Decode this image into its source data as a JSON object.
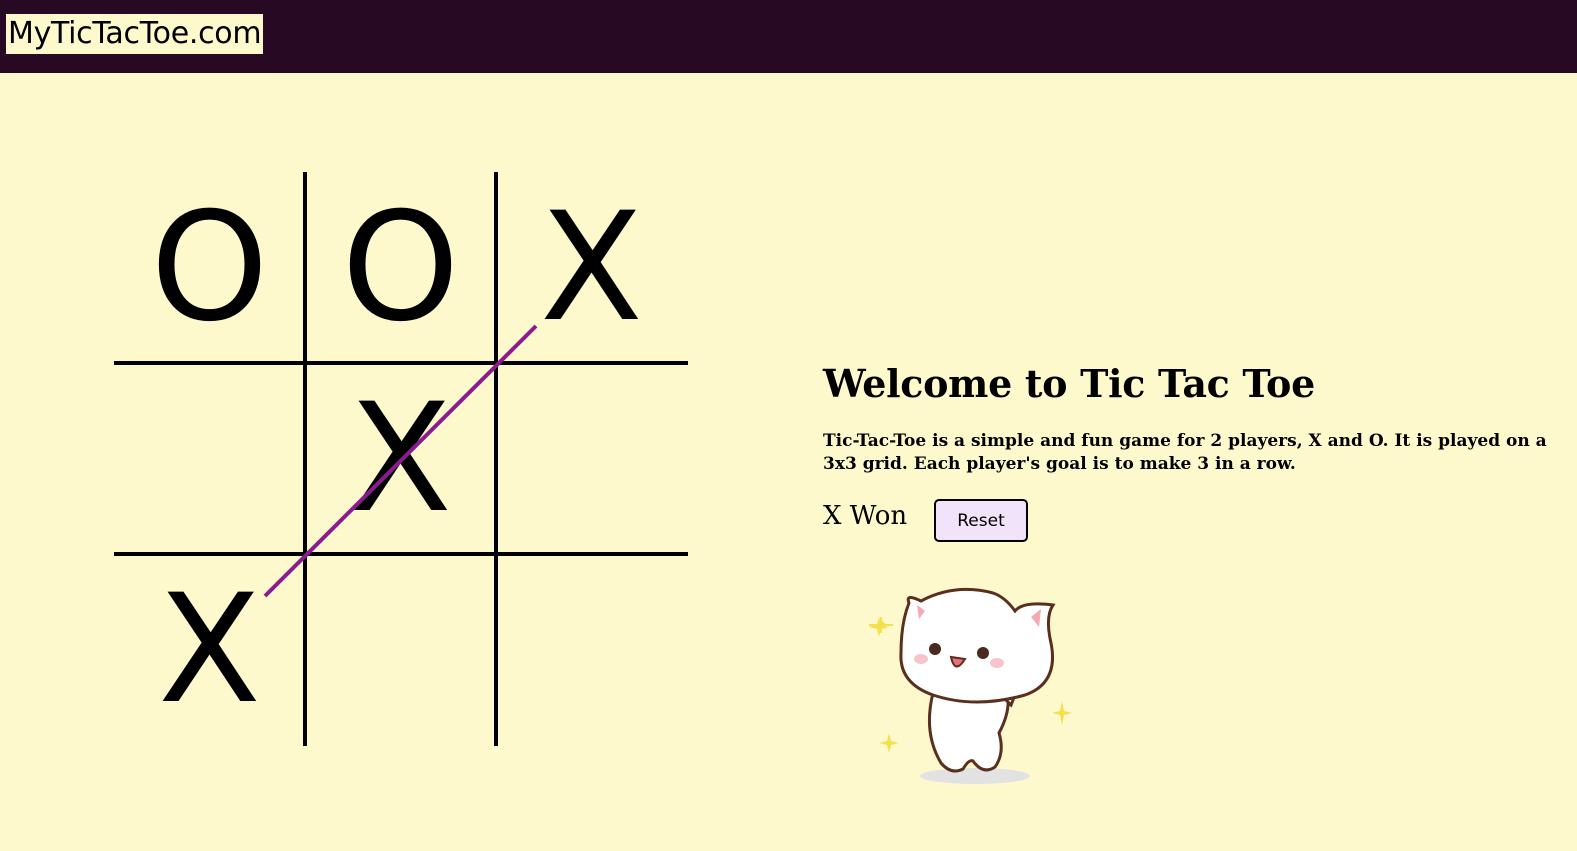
{
  "site": {
    "title": "MyTicTacToe.com"
  },
  "colors": {
    "header_bg": "#270924",
    "page_bg": "#fef8cd",
    "win_line": "#8b1c8f",
    "button_bg": "#f1e4fa"
  },
  "board": {
    "cells": [
      [
        "O",
        "O",
        "X"
      ],
      [
        "",
        "X",
        ""
      ],
      [
        "X",
        "",
        ""
      ]
    ],
    "winning_line": "anti-diagonal"
  },
  "info": {
    "heading": "Welcome to Tic Tac Toe",
    "description": "Tic-Tac-Toe is a simple and fun game for 2 players, X and O. It is played on a 3x3 grid. Each player's goal is to make 3 in a row.",
    "status": "X Won",
    "reset_label": "Reset"
  },
  "mascot": {
    "icon": "cat-mascot-icon"
  }
}
